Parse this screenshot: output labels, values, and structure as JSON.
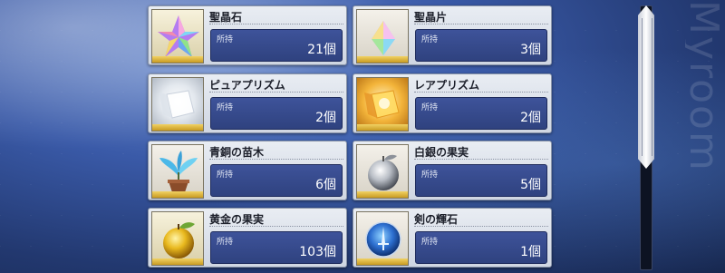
{
  "watermark": "Myroom",
  "count_label": "所持",
  "items": [
    {
      "name": "聖晶石",
      "count": "21個",
      "icon": "saint-quartz-icon"
    },
    {
      "name": "聖晶片",
      "count": "3個",
      "icon": "quartz-fragment-icon"
    },
    {
      "name": "ピュアプリズム",
      "count": "2個",
      "icon": "pure-prism-icon"
    },
    {
      "name": "レアプリズム",
      "count": "2個",
      "icon": "rare-prism-icon"
    },
    {
      "name": "青銅の苗木",
      "count": "6個",
      "icon": "bronze-sapling-icon"
    },
    {
      "name": "白銀の果実",
      "count": "5個",
      "icon": "silver-apple-icon"
    },
    {
      "name": "黄金の果実",
      "count": "103個",
      "icon": "golden-apple-icon"
    },
    {
      "name": "剣の輝石",
      "count": "1個",
      "icon": "saber-gem-icon"
    }
  ],
  "colors": {
    "count_box": "#3e539a",
    "rarity_band": "#e0b63e",
    "card_bg": "#e9edf3"
  }
}
